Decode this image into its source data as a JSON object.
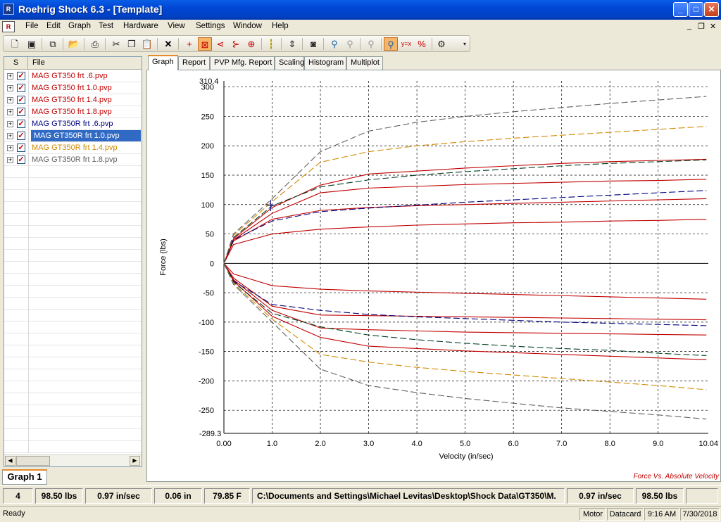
{
  "window": {
    "title": "Roehrig Shock 6.3 - [Template]",
    "min_label": "_",
    "max_label": "□",
    "close_label": "✕"
  },
  "menu": {
    "items": [
      "File",
      "Edit",
      "Graph",
      "Test",
      "Hardware",
      "View",
      "Settings",
      "Window",
      "Help"
    ],
    "mdi_min": "_",
    "mdi_restore": "❐",
    "mdi_close": "✕"
  },
  "toolbar": {
    "icons": [
      "new-file-icon",
      "save-icon",
      "save-all-icon",
      "open-folder-icon",
      "print-icon",
      "cut-icon",
      "copy-icon",
      "paste-icon",
      "delete-icon",
      "cursor-cross-icon",
      "zoom-box-icon",
      "curve-left-icon",
      "curve-mark-icon",
      "phase-icon",
      "probe-icon",
      "axis-icon",
      "camera-icon",
      "zoom-in-icon",
      "zoom-out-icon",
      "zoom-reset-icon",
      "zoom-active-icon",
      "xy-icon",
      "percent-icon",
      "wizard-icon"
    ]
  },
  "file_panel": {
    "header_s": "S",
    "header_file": "File",
    "files": [
      {
        "name": "MAG GT350 frt .6.pvp",
        "color": "#c00000",
        "selected": false
      },
      {
        "name": "MAG GT350 frt 1.0.pvp",
        "color": "#c00000",
        "selected": false
      },
      {
        "name": "MAG GT350 frt 1.4.pvp",
        "color": "#c00000",
        "selected": false
      },
      {
        "name": "MAG GT350 frt 1.8.pvp",
        "color": "#c00000",
        "selected": false
      },
      {
        "name": "MAG GT350R frt .6.pvp",
        "color": "#000080",
        "selected": false
      },
      {
        "name": "MAG GT350R frt 1.0.pvp",
        "color": "#004020",
        "selected": true
      },
      {
        "name": "MAG GT350R frt 1.4.pvp",
        "color": "#d08a00",
        "selected": false
      },
      {
        "name": "MAG GT350R frt 1.8.pvp",
        "color": "#606060",
        "selected": false
      }
    ]
  },
  "tabs": [
    "Graph",
    "Report",
    "PVP Mfg. Report",
    "Scaling",
    "Histogram",
    "Multiplot"
  ],
  "bottom_tab": "Graph 1",
  "chart_caption": "Force Vs. Absolute Velocity",
  "chart_data": {
    "type": "line",
    "xlabel": "Velocity (in/sec)",
    "ylabel": "Force (lbs)",
    "xlim": [
      0,
      10.04
    ],
    "ylim": [
      -289.3,
      310.4
    ],
    "x_ticks": [
      "0.00",
      "1.0",
      "2.0",
      "3.0",
      "4.0",
      "5.0",
      "6.0",
      "7.0",
      "8.0",
      "9.0",
      "10.04"
    ],
    "y_ticks": [
      "310.4",
      "300",
      "250",
      "200",
      "150",
      "100",
      "50",
      "0",
      "-50",
      "-100",
      "-150",
      "-200",
      "-250",
      "-289.3"
    ],
    "grid": true,
    "x": [
      0,
      0.2,
      1.0,
      2.0,
      3.0,
      4.0,
      5.0,
      6.0,
      7.0,
      8.0,
      9.0,
      10.0
    ],
    "series": [
      {
        "color": "#c00000",
        "dash": false,
        "rebound": [
          0,
          32,
          50,
          58,
          62,
          65,
          67,
          69,
          70,
          72,
          73,
          75
        ],
        "compression": [
          0,
          -18,
          -38,
          -44,
          -47,
          -49,
          -51,
          -53,
          -55,
          -57,
          -59,
          -61
        ]
      },
      {
        "color": "#c00000",
        "dash": false,
        "rebound": [
          0,
          38,
          75,
          90,
          95,
          98,
          100,
          102,
          104,
          106,
          108,
          110
        ],
        "compression": [
          0,
          -25,
          -73,
          -88,
          -89,
          -90,
          -91,
          -92,
          -93,
          -94,
          -95,
          -96
        ]
      },
      {
        "color": "#c00000",
        "dash": false,
        "rebound": [
          0,
          40,
          85,
          120,
          128,
          131,
          134,
          136,
          138,
          140,
          141,
          143
        ],
        "compression": [
          0,
          -28,
          -80,
          -110,
          -113,
          -115,
          -117,
          -118,
          -119,
          -120,
          -121,
          -122
        ]
      },
      {
        "color": "#c00000",
        "dash": false,
        "rebound": [
          0,
          42,
          95,
          133,
          152,
          157,
          162,
          166,
          170,
          173,
          175,
          177
        ],
        "compression": [
          0,
          -30,
          -90,
          -126,
          -141,
          -145,
          -149,
          -152,
          -155,
          -158,
          -161,
          -164
        ]
      },
      {
        "color": "#000080",
        "dash": true,
        "rebound": [
          0,
          40,
          72,
          88,
          94,
          99,
          104,
          108,
          112,
          116,
          120,
          124
        ],
        "compression": [
          0,
          -30,
          -70,
          -80,
          -87,
          -91,
          -94,
          -97,
          -100,
          -102,
          -104,
          -106
        ]
      },
      {
        "color": "#004020",
        "dash": true,
        "rebound": [
          0,
          44,
          98,
          130,
          142,
          150,
          156,
          161,
          166,
          170,
          173,
          176
        ],
        "compression": [
          0,
          -32,
          -85,
          -108,
          -122,
          -130,
          -136,
          -141,
          -145,
          -148,
          -153,
          -157
        ]
      },
      {
        "color": "#d08a00",
        "dash": true,
        "rebound": [
          0,
          48,
          105,
          172,
          190,
          200,
          207,
          213,
          218,
          223,
          228,
          233
        ],
        "compression": [
          0,
          -34,
          -95,
          -155,
          -168,
          -177,
          -184,
          -190,
          -196,
          -202,
          -208,
          -215
        ]
      },
      {
        "color": "#606060",
        "dash": true,
        "rebound": [
          0,
          50,
          110,
          190,
          225,
          240,
          250,
          258,
          265,
          272,
          278,
          284
        ],
        "compression": [
          0,
          -36,
          -100,
          -180,
          -208,
          -220,
          -230,
          -238,
          -246,
          -252,
          -258,
          -265
        ]
      }
    ]
  },
  "readout": [
    "4",
    "98.50 lbs",
    "0.97 in/sec",
    "0.06 in",
    "79.85 F",
    "C:\\Documents and Settings\\Michael Levitas\\Desktop\\Shock Data\\GT350\\M.",
    "0.97 in/sec",
    "98.50 lbs",
    ""
  ],
  "status": {
    "text": "Ready",
    "motor": "Motor",
    "datacard": "Datacard",
    "time": "9:16 AM",
    "date": "7/30/2018"
  }
}
